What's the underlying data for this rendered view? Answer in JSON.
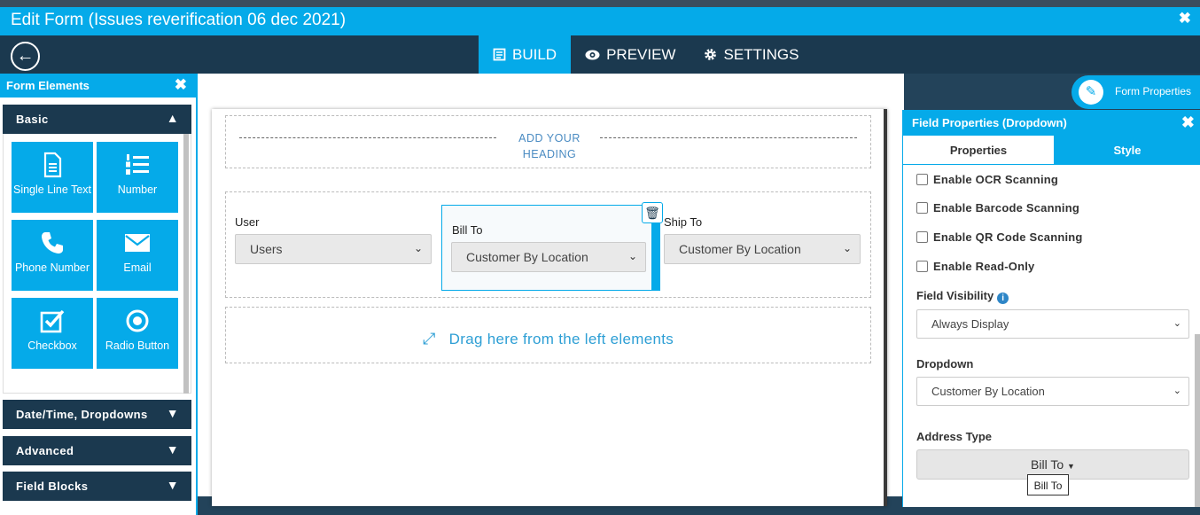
{
  "window": {
    "title": "Edit Form (Issues reverification 06 dec 2021)",
    "close": "✖"
  },
  "nav": {
    "back": "←",
    "tabs": [
      {
        "label": "BUILD",
        "icon": "form-icon"
      },
      {
        "label": "PREVIEW",
        "icon": "eye-icon"
      },
      {
        "label": "SETTINGS",
        "icon": "gear-icon"
      }
    ]
  },
  "left_panel": {
    "title": "Form Elements",
    "close": "✖",
    "sections": [
      "Basic",
      "Date/Time, Dropdowns",
      "Advanced",
      "Field Blocks"
    ],
    "tiles": [
      {
        "label": "Single Line Text",
        "icon": "document-icon"
      },
      {
        "label": "Number",
        "icon": "numbered-list-icon"
      },
      {
        "label": "Phone Number",
        "icon": "phone-icon"
      },
      {
        "label": "Email",
        "icon": "envelope-icon"
      },
      {
        "label": "Checkbox",
        "icon": "checkbox-icon"
      },
      {
        "label": "Radio Button",
        "icon": "radio-icon"
      }
    ]
  },
  "canvas": {
    "heading": "ADD YOUR HEADING",
    "fields": [
      {
        "label": "User",
        "value": "Users"
      },
      {
        "label": "Bill To",
        "value": "Customer By Location"
      },
      {
        "label": "Ship To",
        "value": "Customer By Location"
      }
    ],
    "drop_text": "Drag here from the left elements",
    "form_properties": "Form Properties"
  },
  "right_panel": {
    "title": "Field Properties (Dropdown)",
    "close": "✖",
    "tabs": [
      "Properties",
      "Style"
    ],
    "checkboxes": [
      "Enable OCR Scanning",
      "Enable Barcode Scanning",
      "Enable QR Code Scanning",
      "Enable Read-Only"
    ],
    "field_visibility_label": "Field Visibility",
    "field_visibility_value": "Always Display",
    "dropdown_label": "Dropdown",
    "dropdown_value": "Customer By Location",
    "address_type_label": "Address Type",
    "address_type_value": "Bill To",
    "tooltip": "Bill To"
  },
  "colors": {
    "accent": "#05aae9",
    "navy": "#1b394f"
  }
}
